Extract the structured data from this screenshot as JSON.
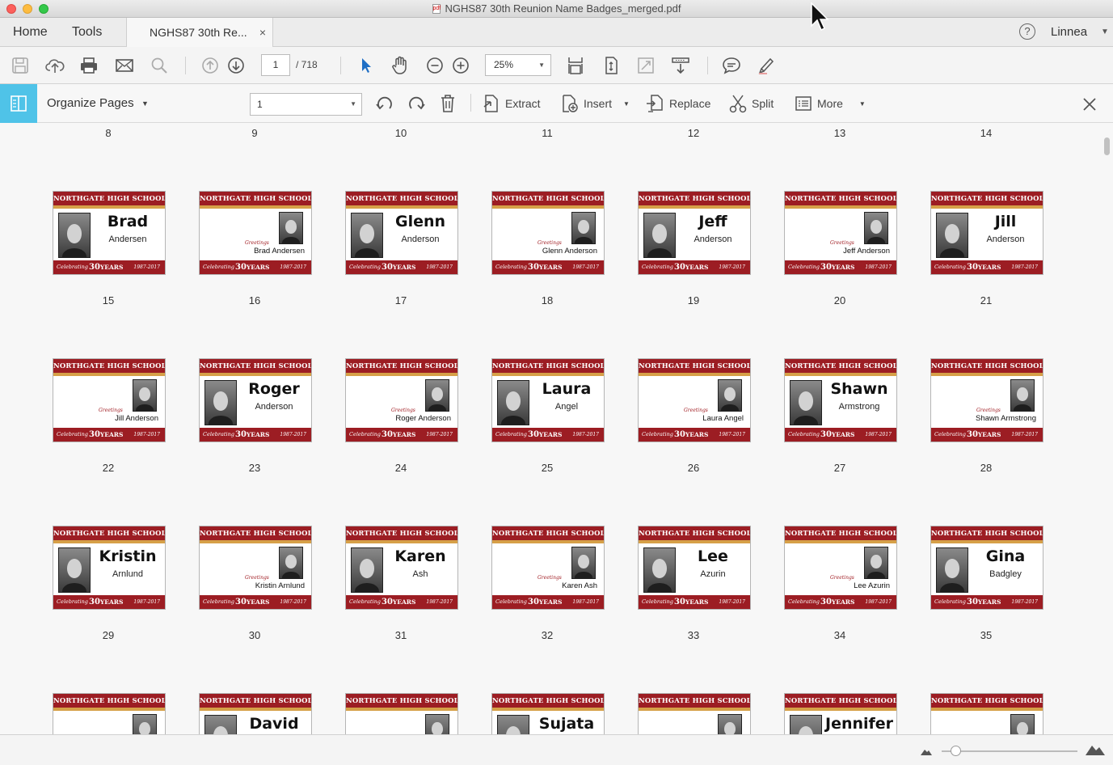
{
  "window": {
    "title": "NGHS87 30th Reunion Name Badges_merged.pdf"
  },
  "nav": {
    "home": "Home",
    "tools": "Tools"
  },
  "tab": {
    "label": "NGHS87 30th Re...",
    "close": "×"
  },
  "account": {
    "help": "?",
    "user": "Linnea"
  },
  "toolbar": {
    "page_current": "1",
    "page_total": "/ 718",
    "zoom": "25%"
  },
  "organize": {
    "title": "Organize Pages",
    "page_select": "1",
    "extract": "Extract",
    "insert": "Insert",
    "replace": "Replace",
    "split": "Split",
    "more": "More"
  },
  "badge_text": {
    "school": "NORTHGATE HIGH SCHOOL",
    "celebrating": "Celebrating",
    "years": "30",
    "years_word": "YEARS",
    "dates": "1987-2017",
    "greeting": "Greetings"
  },
  "colors": {
    "badge_red": "#9c1d23",
    "badge_gold": "#d6a048",
    "organize_accent": "#4fc3e8"
  },
  "rows": [
    {
      "pages": [
        {
          "num": "8",
          "first": "Brad",
          "last": "Andersen",
          "style": "large"
        },
        {
          "num": "9",
          "small": "Brad  Andersen",
          "style": "small"
        },
        {
          "num": "10",
          "first": "Glenn",
          "last": "Anderson",
          "style": "large"
        },
        {
          "num": "11",
          "small": "Glenn  Anderson",
          "style": "small"
        },
        {
          "num": "12",
          "first": "Jeff",
          "last": "Anderson",
          "style": "large"
        },
        {
          "num": "13",
          "small": "Jeff Anderson",
          "style": "small"
        },
        {
          "num": "14",
          "first": "Jill",
          "last": "Anderson",
          "style": "large"
        }
      ]
    },
    {
      "pages": [
        {
          "num": "15",
          "small": "Jill Anderson",
          "style": "small"
        },
        {
          "num": "16",
          "first": "Roger",
          "last": "Anderson",
          "style": "large"
        },
        {
          "num": "17",
          "small": "Roger  Anderson",
          "style": "small"
        },
        {
          "num": "18",
          "first": "Laura",
          "last": "Angel",
          "style": "large"
        },
        {
          "num": "19",
          "small": "Laura Angel",
          "style": "small"
        },
        {
          "num": "20",
          "first": "Shawn",
          "last": "Armstrong",
          "style": "large"
        },
        {
          "num": "21",
          "small": "Shawn Armstrong",
          "style": "small"
        }
      ]
    },
    {
      "pages": [
        {
          "num": "22",
          "first": "Kristin",
          "last": "Arnlund",
          "style": "large"
        },
        {
          "num": "23",
          "small": "Kristin Arnlund",
          "style": "small"
        },
        {
          "num": "24",
          "first": "Karen",
          "last": "Ash",
          "style": "large"
        },
        {
          "num": "25",
          "small": "Karen  Ash",
          "style": "small"
        },
        {
          "num": "26",
          "first": "Lee",
          "last": "Azurin",
          "style": "large"
        },
        {
          "num": "27",
          "small": "Lee Azurin",
          "style": "small"
        },
        {
          "num": "28",
          "first": "Gina",
          "last": "Badgley",
          "style": "large"
        }
      ]
    },
    {
      "pages": [
        {
          "num": "29",
          "style": "small"
        },
        {
          "num": "30",
          "first": "David",
          "style": "large"
        },
        {
          "num": "31",
          "style": "small"
        },
        {
          "num": "32",
          "first": "Sujata",
          "style": "large"
        },
        {
          "num": "33",
          "style": "small"
        },
        {
          "num": "34",
          "first": "Jennifer",
          "style": "large"
        },
        {
          "num": "35",
          "style": "small"
        }
      ]
    }
  ]
}
